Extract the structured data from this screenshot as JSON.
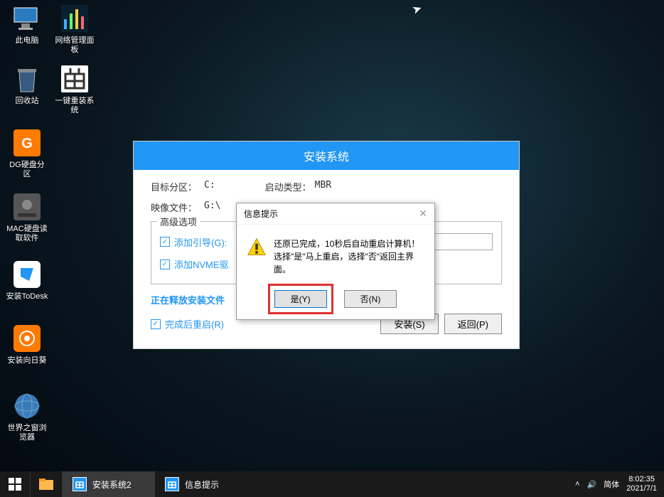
{
  "desktop": {
    "icons": [
      {
        "label": "此电脑"
      },
      {
        "label": "网络管理面板"
      },
      {
        "label": "回收站"
      },
      {
        "label": "一键重装系统"
      },
      {
        "label": "DG硬盘分区"
      },
      {
        "label": "MAC硬盘读取软件"
      },
      {
        "label": "安装ToDesk"
      },
      {
        "label": "安装向日葵"
      },
      {
        "label": "世界之窗浏览器"
      }
    ]
  },
  "installer": {
    "title": "安装系统",
    "target_label": "目标分区：",
    "target_value": "C:",
    "boot_label": "启动类型：",
    "boot_value": "MBR",
    "image_label": "映像文件：",
    "image_value": "G:\\",
    "adv_title": "高级选项",
    "chk_boot": "添加引导(G):",
    "chk_nvme": "添加NVME驱",
    "progress": "正在释放安装文件",
    "chk_restart": "完成后重启(R)",
    "btn_install": "安装(S)",
    "btn_back": "返回(P)"
  },
  "dialog": {
    "title": "信息提示",
    "msg_line1": "还原已完成，10秒后自动重启计算机！",
    "msg_line2": "选择\"是\"马上重启，选择\"否\"返回主界面。",
    "btn_yes": "是(Y)",
    "btn_no": "否(N)"
  },
  "taskbar": {
    "task1": "安装系统2",
    "task2": "信息提示",
    "ime": "简体",
    "time": "8:02:35",
    "date": "2021/7/1"
  }
}
